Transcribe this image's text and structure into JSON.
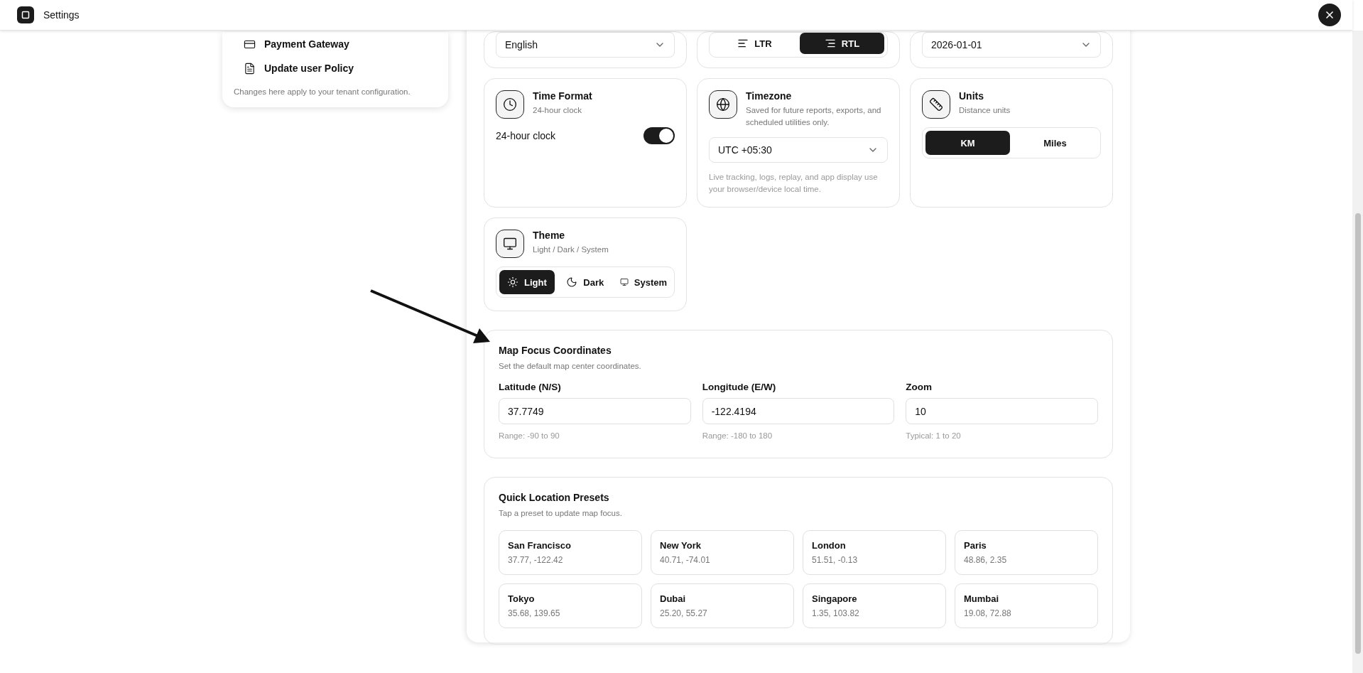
{
  "header": {
    "title": "Settings"
  },
  "sidebar": {
    "items": [
      {
        "label": "Payment Gateway"
      },
      {
        "label": "Update user Policy"
      }
    ],
    "note": "Changes here apply to your tenant configuration."
  },
  "top_row": {
    "language": {
      "value": "English"
    },
    "direction": {
      "options": [
        {
          "label": "LTR",
          "selected": false
        },
        {
          "label": "RTL",
          "selected": true
        }
      ]
    },
    "date": {
      "value": "2026-01-01"
    }
  },
  "settings_cards": [
    {
      "kind": "toggle",
      "title": "Time Format",
      "subtitle": "24-hour clock",
      "label": "24-hour clock",
      "on": true
    },
    {
      "kind": "select",
      "title": "Timezone",
      "subtitle": "Saved for future reports, exports, and scheduled utilities only.",
      "value": "UTC +05:30",
      "hint": "Live tracking, logs, replay, and app display use your browser/device local time."
    },
    {
      "kind": "segmented",
      "title": "Units",
      "subtitle": "Distance units",
      "options": [
        {
          "label": "KM",
          "selected": true
        },
        {
          "label": "Miles",
          "selected": false
        }
      ]
    },
    {
      "kind": "segmented",
      "title": "Theme",
      "subtitle": "Light / Dark / System",
      "options": [
        {
          "label": "Light",
          "selected": true
        },
        {
          "label": "Dark",
          "selected": false
        },
        {
          "label": "System",
          "selected": false
        }
      ]
    }
  ],
  "map_focus": {
    "title": "Map Focus Coordinates",
    "subtitle": "Set the default map center coordinates.",
    "fields": [
      {
        "label": "Latitude (N/S)",
        "value": "37.7749",
        "hint": "Range: -90 to 90"
      },
      {
        "label": "Longitude (E/W)",
        "value": "-122.4194",
        "hint": "Range: -180 to 180"
      },
      {
        "label": "Zoom",
        "value": "10",
        "hint": "Typical: 1 to 20"
      }
    ]
  },
  "presets": {
    "title": "Quick Location Presets",
    "subtitle": "Tap a preset to update map focus.",
    "items": [
      {
        "name": "San Francisco",
        "coords": "37.77, -122.42"
      },
      {
        "name": "New York",
        "coords": "40.71, -74.01"
      },
      {
        "name": "London",
        "coords": "51.51, -0.13"
      },
      {
        "name": "Paris",
        "coords": "48.86, 2.35"
      },
      {
        "name": "Tokyo",
        "coords": "35.68, 139.65"
      },
      {
        "name": "Dubai",
        "coords": "25.20, 55.27"
      },
      {
        "name": "Singapore",
        "coords": "1.35, 103.82"
      },
      {
        "name": "Mumbai",
        "coords": "19.08, 72.88"
      }
    ]
  }
}
